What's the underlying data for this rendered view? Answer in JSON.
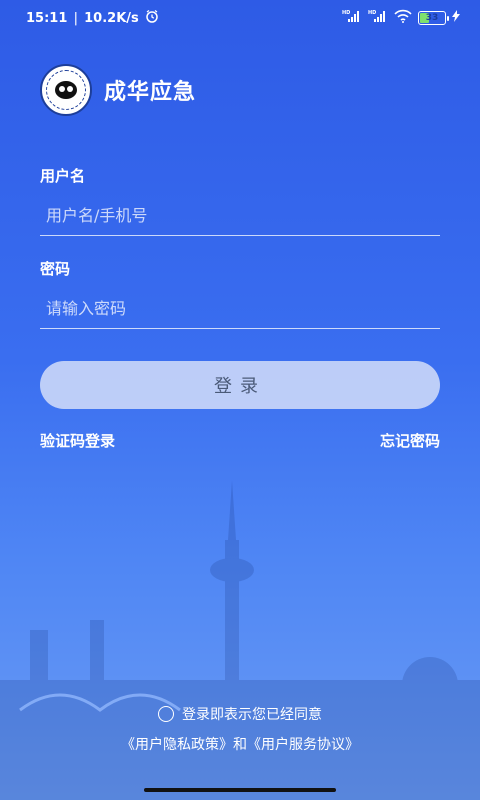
{
  "status_bar": {
    "time": "15:11",
    "speed": "10.2K/s",
    "signal_1": "HD",
    "signal_2": "HD",
    "battery": "33"
  },
  "brand": {
    "logo_text": "应急管理 EMERGENCY MANAGEMENT",
    "name": "成华应急"
  },
  "form": {
    "username_label": "用户名",
    "username_placeholder": "用户名/手机号",
    "password_label": "密码",
    "password_placeholder": "请输入密码",
    "login_button": "登录"
  },
  "links": {
    "sms_login": "验证码登录",
    "forgot_password": "忘记密码"
  },
  "agreement": {
    "text": "登录即表示您已经同意",
    "privacy_policy": "《用户隐私政策》",
    "and": "和",
    "service_agreement": "《用户服务协议》"
  },
  "colors": {
    "background_top": "#2e5be6",
    "background_bottom": "#6b9cf4",
    "button_bg": "#e1e8fa"
  }
}
